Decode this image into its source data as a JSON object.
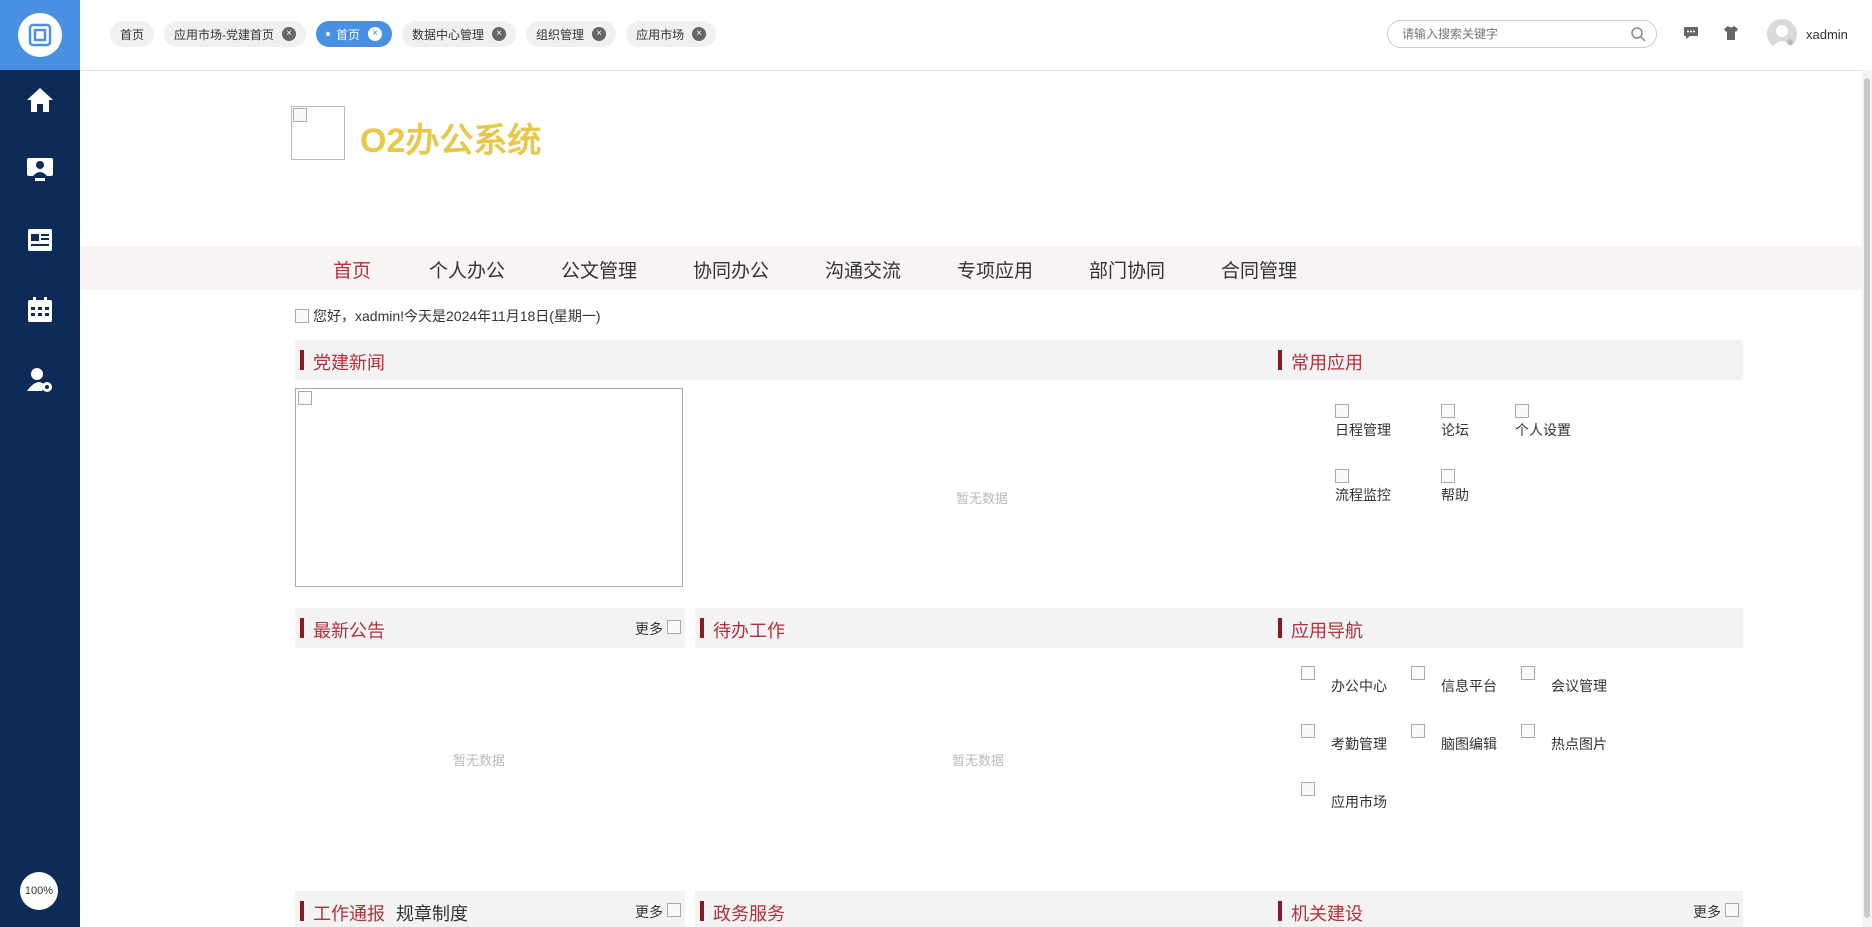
{
  "sidebar": {
    "icons": [
      "home-icon",
      "monitor-user-icon",
      "news-icon",
      "calendar-icon",
      "user-settings-icon"
    ],
    "zoom": "100%"
  },
  "tabs": [
    {
      "label": "首页",
      "closable": false,
      "active": false
    },
    {
      "label": "应用市场-党建首页",
      "closable": true,
      "active": false
    },
    {
      "label": "首页",
      "closable": true,
      "active": true
    },
    {
      "label": "数据中心管理",
      "closable": true,
      "active": false
    },
    {
      "label": "组织管理",
      "closable": true,
      "active": false
    },
    {
      "label": "应用市场",
      "closable": true,
      "active": false
    }
  ],
  "search": {
    "placeholder": "请输入搜索关键字"
  },
  "user": {
    "name": "xadmin"
  },
  "brand": {
    "title": "O2办公系统"
  },
  "mainnav": {
    "items": [
      "首页",
      "个人办公",
      "公文管理",
      "协同办公",
      "沟通交流",
      "专项应用",
      "部门协同",
      "合同管理"
    ],
    "active": 0
  },
  "greeting": "您好，xadmin!今天是2024年11月18日(星期一)",
  "more_label": "更多",
  "empty_label": "暂无数据",
  "panels": {
    "party_news": "党建新闻",
    "common_apps": "常用应用",
    "latest_notice": "最新公告",
    "todo": "待办工作",
    "app_nav": "应用导航",
    "work_report": "工作通报",
    "rules": "规章制度",
    "gov_service": "政务服务",
    "org_building": "机关建设"
  },
  "common_apps": [
    "日程管理",
    "论坛",
    "个人设置",
    "流程监控",
    "帮助"
  ],
  "app_nav": [
    "办公中心",
    "信息平台",
    "会议管理",
    "考勤管理",
    "脑图编辑",
    "热点图片",
    "应用市场"
  ]
}
